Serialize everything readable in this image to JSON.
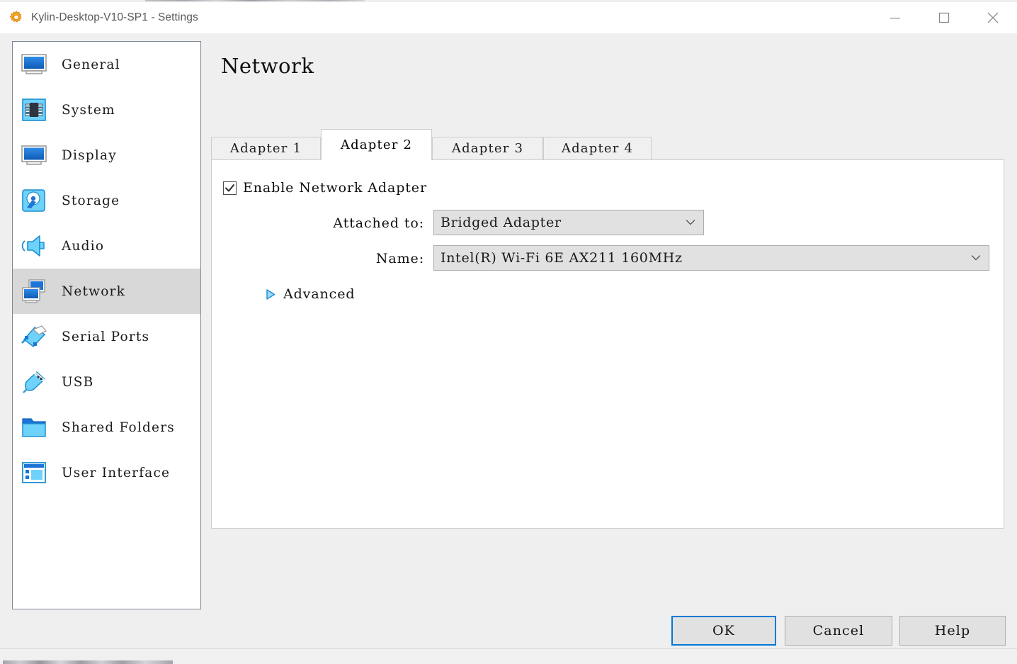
{
  "window": {
    "title": "Kylin-Desktop-V10-SP1 - Settings",
    "icon": "gear-icon",
    "controls": {
      "minimize": "minimize-icon",
      "maximize": "maximize-icon",
      "close": "close-icon"
    }
  },
  "sidebar": {
    "items": [
      {
        "label": "General",
        "icon": "monitor-icon",
        "selected": false
      },
      {
        "label": "System",
        "icon": "chip-icon",
        "selected": false
      },
      {
        "label": "Display",
        "icon": "display-icon",
        "selected": false
      },
      {
        "label": "Storage",
        "icon": "harddisk-icon",
        "selected": false
      },
      {
        "label": "Audio",
        "icon": "speaker-icon",
        "selected": false
      },
      {
        "label": "Network",
        "icon": "network-cards-icon",
        "selected": true
      },
      {
        "label": "Serial Ports",
        "icon": "serial-port-icon",
        "selected": false
      },
      {
        "label": "USB",
        "icon": "usb-icon",
        "selected": false
      },
      {
        "label": "Shared Folders",
        "icon": "folder-icon",
        "selected": false
      },
      {
        "label": "User Interface",
        "icon": "window-layout-icon",
        "selected": false
      }
    ]
  },
  "main": {
    "page_title": "Network",
    "tabs": [
      {
        "label": "Adapter 1",
        "active": false
      },
      {
        "label": "Adapter 2",
        "active": true
      },
      {
        "label": "Adapter 3",
        "active": false
      },
      {
        "label": "Adapter 4",
        "active": false
      }
    ],
    "enable_adapter": {
      "label": "Enable Network Adapter",
      "checked": true
    },
    "attached_to": {
      "label": "Attached to:",
      "value": "Bridged Adapter"
    },
    "name": {
      "label": "Name:",
      "value": "Intel(R) Wi-Fi 6E AX211 160MHz"
    },
    "advanced": {
      "label": "Advanced",
      "expanded": false
    }
  },
  "footer": {
    "ok": "OK",
    "cancel": "Cancel",
    "help": "Help"
  },
  "colors": {
    "accent": "#0078d7",
    "selection": "#d8d8d8",
    "control_face": "#e1e1e1",
    "window_bg": "#efefef"
  }
}
